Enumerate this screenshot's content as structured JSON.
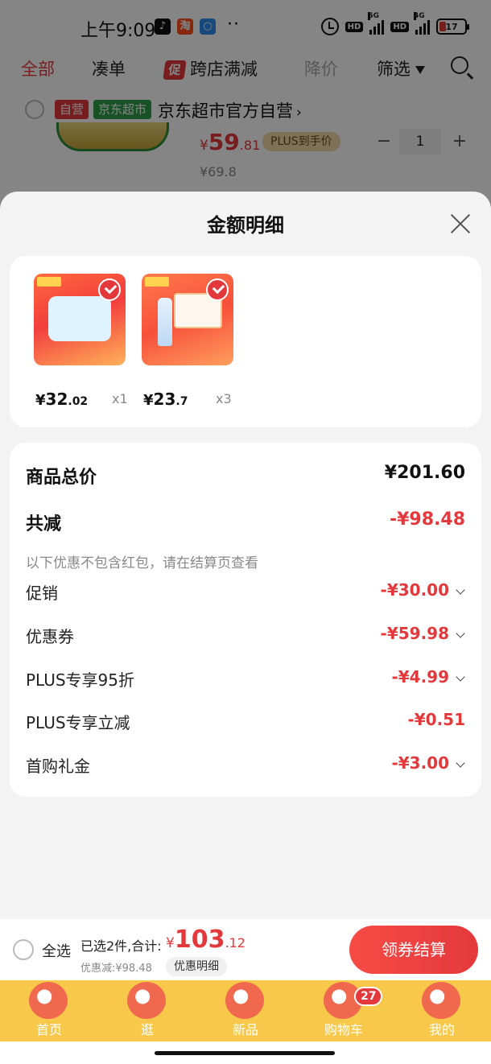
{
  "status_bar": {
    "time": "上午9:09",
    "app_icons": [
      "tiktok-icon",
      "taobao-icon",
      "chat-app-icon"
    ],
    "app_icon_glyphs": [
      "♪",
      "淘",
      "○"
    ],
    "more": "··",
    "hd1": "HD",
    "net1": "5G",
    "hd2": "HD",
    "net2": "4G",
    "battery": "17",
    "battery_color": "#e53935"
  },
  "cart_tabs": {
    "all": "全部",
    "bundle": "凑单",
    "promo_badge": "促",
    "cross_store": "跨店满减",
    "price_drop": "降价",
    "filter": "筛选"
  },
  "store": {
    "tag_self": "自营",
    "tag_market": "京东超市",
    "name": "京东超市官方自营",
    "chevron": "›"
  },
  "bg_item": {
    "price_symbol": "¥",
    "price_int": "59",
    "price_dec": ".81",
    "plus_label": "PLUS到手价",
    "qty_minus": "−",
    "qty": "1",
    "qty_plus": "+",
    "original_price": "¥69.8"
  },
  "sheet": {
    "title": "金额明细"
  },
  "products": [
    {
      "price_symbol": "¥",
      "price_int": "32",
      "price_dec": ".02",
      "qty": "x1"
    },
    {
      "price_symbol": "¥",
      "price_int": "23",
      "price_dec": ".7",
      "qty": "x3"
    }
  ],
  "summary": {
    "total_label": "商品总价",
    "total_amount": "¥201.60",
    "reduce_label": "共减",
    "reduce_amount": "-¥98.48",
    "note": "以下优惠不包含红包，请在结算页查看",
    "items": [
      {
        "label": "促销",
        "amount": "-¥30.00"
      },
      {
        "label": "优惠券",
        "amount": "-¥59.98"
      },
      {
        "label": "PLUS专享95折",
        "amount": "-¥4.99"
      },
      {
        "label": "PLUS专享立减",
        "amount": "-¥0.51"
      },
      {
        "label": "首购礼金",
        "amount": "-¥3.00"
      }
    ]
  },
  "checkout": {
    "select_all": "全选",
    "selected_count": "已选2件,合计:",
    "total_symbol": "¥",
    "total_int": "103",
    "total_dec": ".12",
    "discount": "优惠减:¥98.48",
    "detail_button": "优惠明细",
    "settle_button": "领券结算"
  },
  "bottom_nav": {
    "items": [
      "首页",
      "逛",
      "新品",
      "购物车",
      "我的"
    ],
    "cart_badge": "27"
  },
  "colors": {
    "accent": "#e4393c",
    "nav_bg": "#f7c84a"
  }
}
